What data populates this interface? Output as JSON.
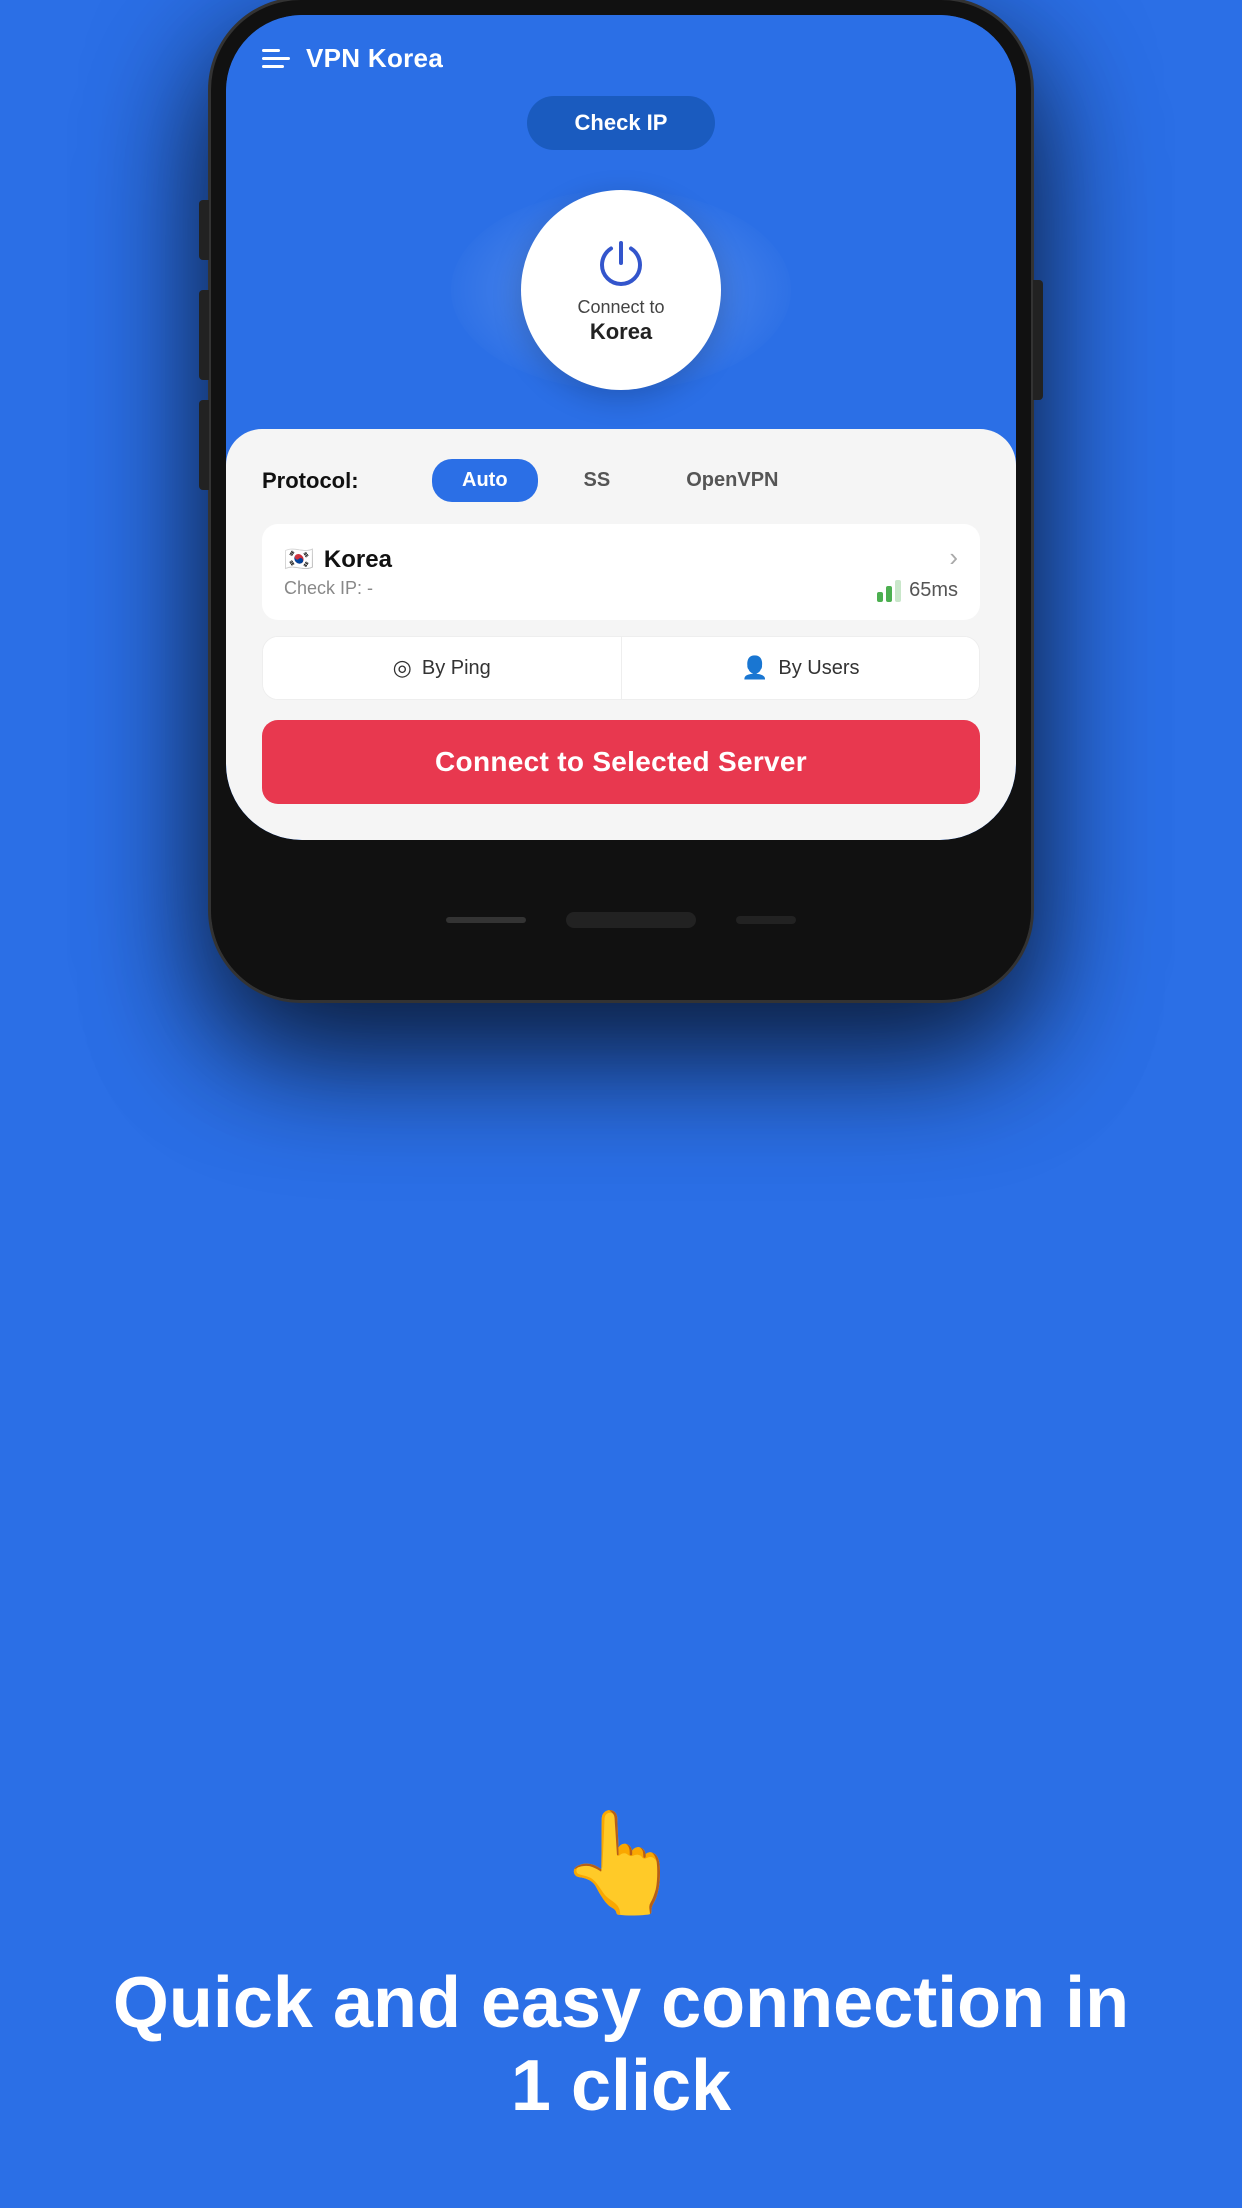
{
  "background_color": "#2B6FE6",
  "app": {
    "title": "VPN Korea"
  },
  "header": {
    "check_ip_label": "Check IP"
  },
  "power_button": {
    "connect_to_label": "Connect to",
    "country_label": "Korea"
  },
  "protocol": {
    "label": "Protocol:",
    "options": [
      "Auto",
      "SS",
      "OpenVPN"
    ],
    "active": "Auto"
  },
  "server": {
    "flag": "🇰🇷",
    "name": "Korea",
    "check_ip_text": "Check IP: -",
    "ping": "65ms"
  },
  "sort": {
    "by_ping_label": "By Ping",
    "by_users_label": "By Users"
  },
  "connect_button": {
    "label": "Connect to Selected Server"
  },
  "tagline": {
    "emoji": "👆",
    "text": "Quick and easy connection in 1 click"
  }
}
